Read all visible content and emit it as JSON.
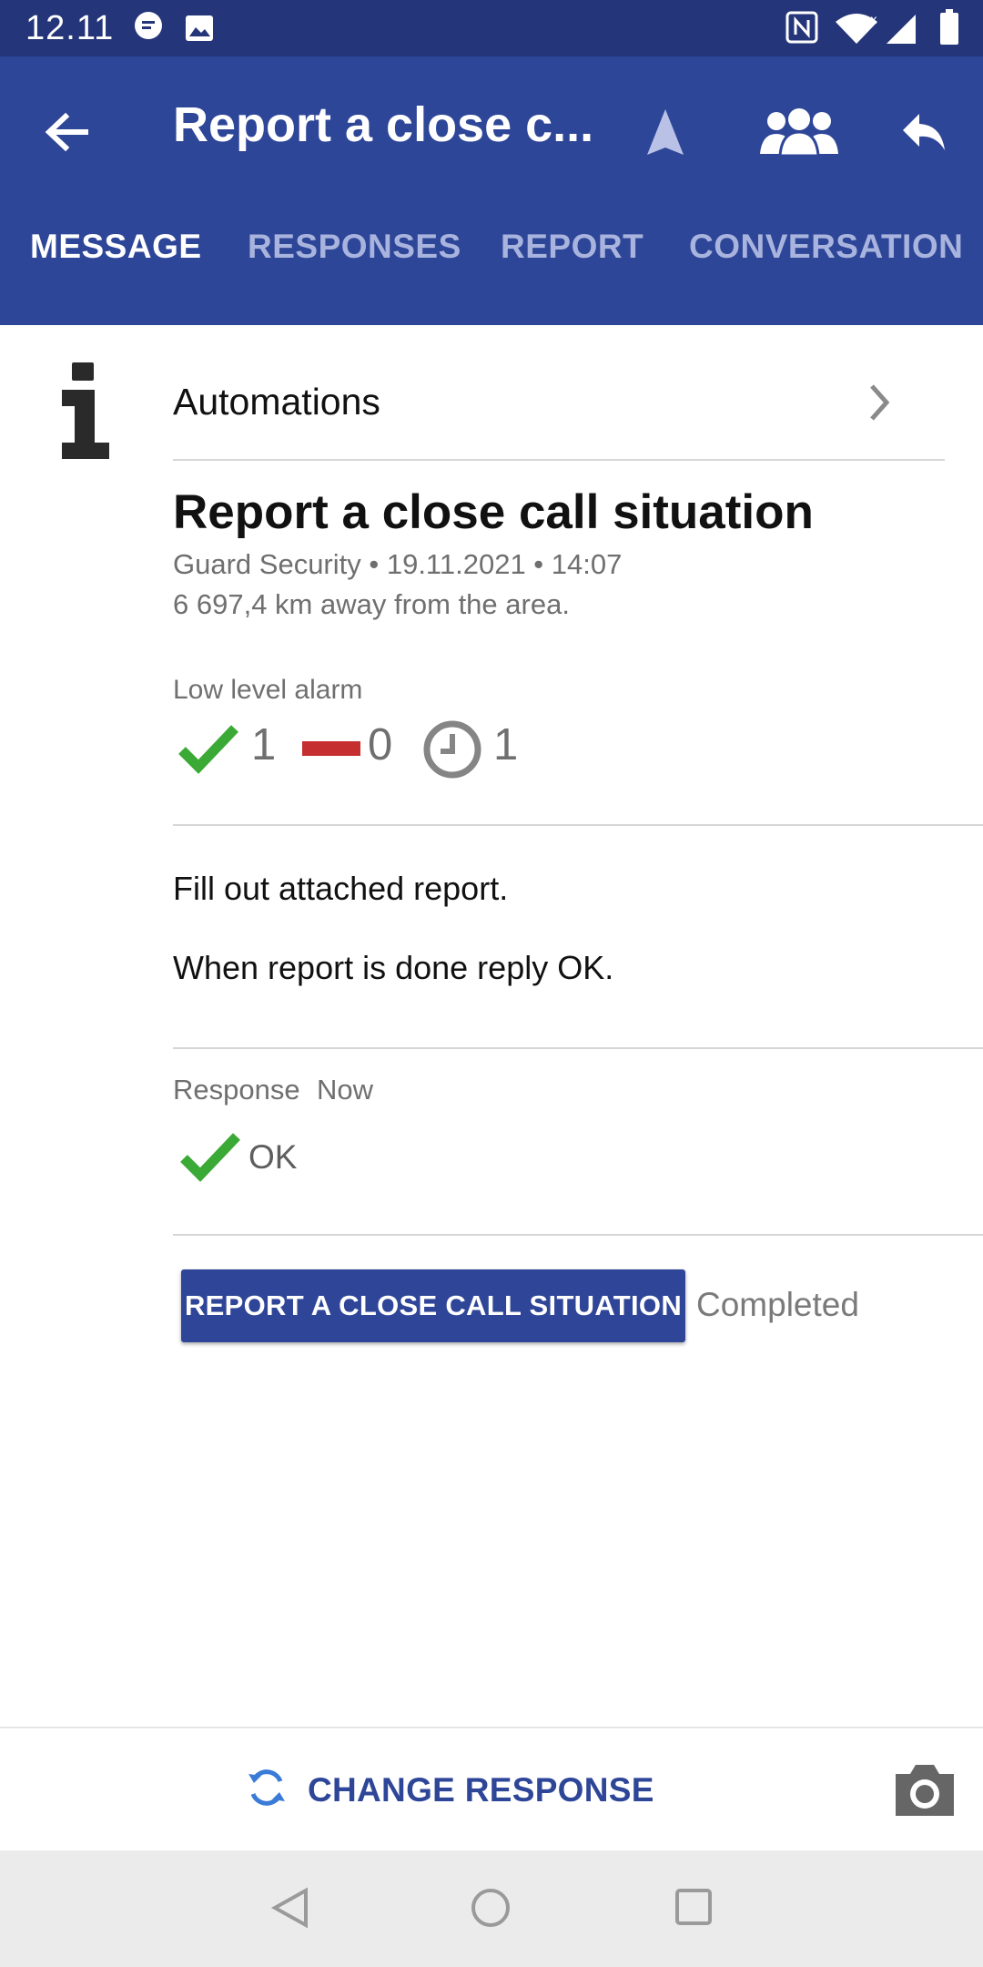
{
  "status_bar": {
    "time": "12.11",
    "icons": [
      "chat-notification-icon",
      "image-icon",
      "nfc-icon",
      "wifi-icon",
      "cell-signal-icon",
      "battery-icon"
    ]
  },
  "app_bar": {
    "title": "Report a close c...",
    "icons": [
      "back-arrow-icon",
      "navigation-icon",
      "group-icon",
      "reply-icon"
    ]
  },
  "tabs": [
    {
      "label": "MESSAGE",
      "active": true
    },
    {
      "label": "RESPONSES",
      "active": false
    },
    {
      "label": "REPORT",
      "active": false
    },
    {
      "label": "CONVERSATION",
      "active": false
    }
  ],
  "automations": {
    "label": "Automations"
  },
  "message": {
    "title": "Report a close call situation",
    "sender_line": "Guard Security • 19.11.2021 • 14:07",
    "distance": "6 697,4 km away from the area.",
    "alarm_level": "Low level alarm",
    "counts": {
      "accepted": "1",
      "declined": "0",
      "pending": "1"
    },
    "body_line1": "Fill out attached report.",
    "body_line2": "When report is done reply OK."
  },
  "response": {
    "label": "Response",
    "time": "Now",
    "value": "OK"
  },
  "report_button": {
    "label": "REPORT A CLOSE CALL SITUATION",
    "status": "Completed"
  },
  "bottom_bar": {
    "change_response_label": "CHANGE RESPONSE"
  },
  "colors": {
    "primary": "#2e4698",
    "status_bar": "#243579",
    "check_green": "#3aa935",
    "decline_red": "#c62f2f"
  }
}
